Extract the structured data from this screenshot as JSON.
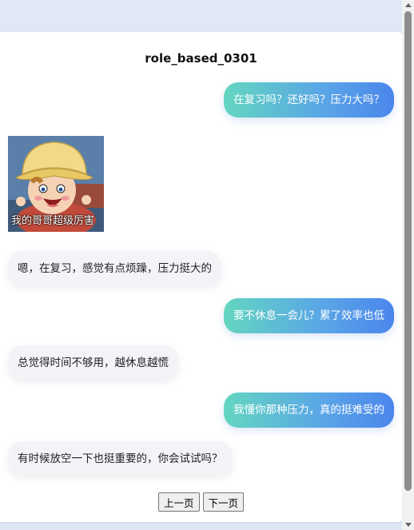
{
  "page": {
    "title": "role_based_0301"
  },
  "messages": [
    {
      "side": "right",
      "text": "在复习吗？还好吗？压力大吗？"
    },
    {
      "side": "left",
      "type": "sticker",
      "caption": "我的哥哥超级厉害",
      "icon": "cartoon-boy-sticker"
    },
    {
      "side": "left",
      "text": "嗯，在复习，感觉有点烦躁，压力挺大的"
    },
    {
      "side": "right",
      "text": "要不休息一会儿？累了效率也低"
    },
    {
      "side": "left",
      "text": "总觉得时间不够用，越休息越慌"
    },
    {
      "side": "right",
      "text": "我懂你那种压力，真的挺难受的"
    },
    {
      "side": "left",
      "text": "有时候放空一下也挺重要的，你会试试吗？"
    }
  ],
  "pager": {
    "prev_label": "上一页",
    "next_label": "下一页"
  },
  "colors": {
    "right_bubble_start": "#63d6c0",
    "right_bubble_end": "#4a86ec",
    "left_bubble": "#f2f4f8"
  }
}
